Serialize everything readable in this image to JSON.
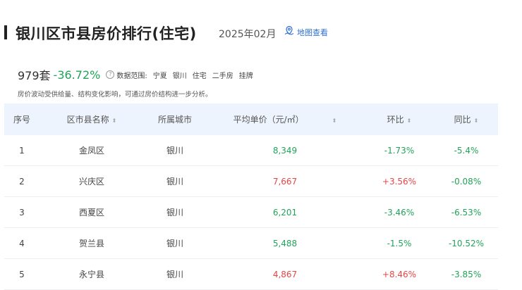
{
  "header": {
    "title": "银川区市县房价排行(住宅)",
    "date": "2025年02月",
    "map_link": "地图查看"
  },
  "stats": {
    "count": "979套",
    "change": "-36.72%",
    "range_label": "数据范围:",
    "range_items": [
      "宁夏",
      "银川",
      "住宅",
      "二手房",
      "挂牌"
    ]
  },
  "note": "房价波动受供给量、结构变化影响，可通过房价结构进一步分析。",
  "table": {
    "columns": [
      "序号",
      "区市县名称",
      "所属城市",
      "平均单价（元/㎡）",
      "环比",
      "同比"
    ],
    "rows": [
      {
        "rank": "1",
        "district": "金凤区",
        "city": "银川",
        "price": "8,349",
        "mom": "-1.73%",
        "yoy": "-5.4%"
      },
      {
        "rank": "2",
        "district": "兴庆区",
        "city": "银川",
        "price": "7,667",
        "mom": "+3.56%",
        "yoy": "-0.08%"
      },
      {
        "rank": "3",
        "district": "西夏区",
        "city": "银川",
        "price": "6,201",
        "mom": "-3.46%",
        "yoy": "-6.53%"
      },
      {
        "rank": "4",
        "district": "贺兰县",
        "city": "银川",
        "price": "5,488",
        "mom": "-1.5%",
        "yoy": "-10.52%"
      },
      {
        "rank": "5",
        "district": "永宁县",
        "city": "银川",
        "price": "4,867",
        "mom": "+8.46%",
        "yoy": "-3.85%"
      }
    ]
  },
  "colors": {
    "up": "#e54545",
    "down": "#22a35a",
    "link": "#2d6fd6",
    "header_bg": "#eef4fd"
  }
}
